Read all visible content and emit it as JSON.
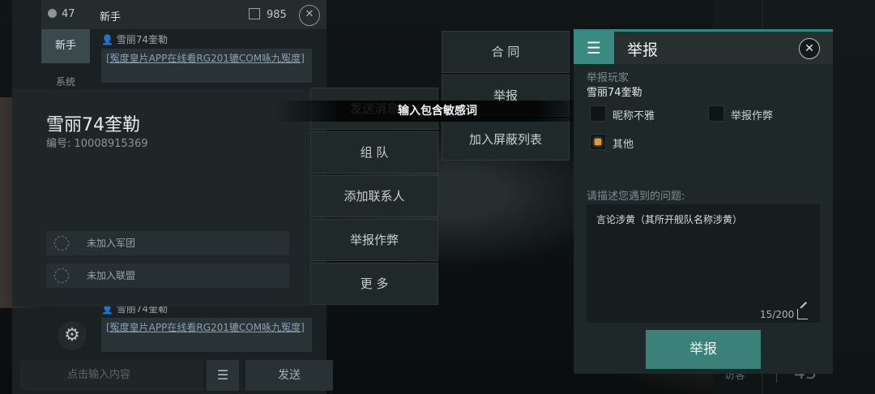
{
  "chat": {
    "member_count": "47",
    "channel_title": "新手",
    "score": "985",
    "tabs": [
      "新手",
      "系统"
    ],
    "messages": [
      {
        "author": "雪丽74奎勒",
        "text": "[冤度皇片APP在线看RG201辘COM咏九冤度]"
      },
      {
        "author": "雪丽74奎勒",
        "text": "[冤度皇片APP在线看RG201辘COM咏九冤度]"
      }
    ],
    "input_placeholder": "点击输入内容",
    "send_label": "发送"
  },
  "player_card": {
    "name": "雪丽74奎勒",
    "id_text": "编号: 10008915369",
    "legion": "未加入军团",
    "alliance": "未加入联盟"
  },
  "menu": {
    "items": [
      "发送消息",
      "组 队",
      "添加联系人",
      "举报作弊",
      "更 多"
    ],
    "items2": [
      "合 同",
      "举报",
      "加入屏蔽列表"
    ]
  },
  "toast": "输入包含敏感词",
  "report": {
    "title": "举报",
    "player_label": "举报玩家",
    "player_name": "雪丽74奎勒",
    "options": [
      {
        "label": "昵称不雅",
        "checked": false
      },
      {
        "label": "举报作弊",
        "checked": false
      },
      {
        "label": "其他",
        "checked": true
      }
    ],
    "desc_label": "请描述您遇到的问题:",
    "desc_text": "言论涉黄（其所开舰队名称涉黄）",
    "counter": "15/200",
    "submit_label": "举报",
    "accent": "#3a8a82"
  },
  "background": {
    "visitor_label": "访客",
    "visitor_count": "43"
  }
}
